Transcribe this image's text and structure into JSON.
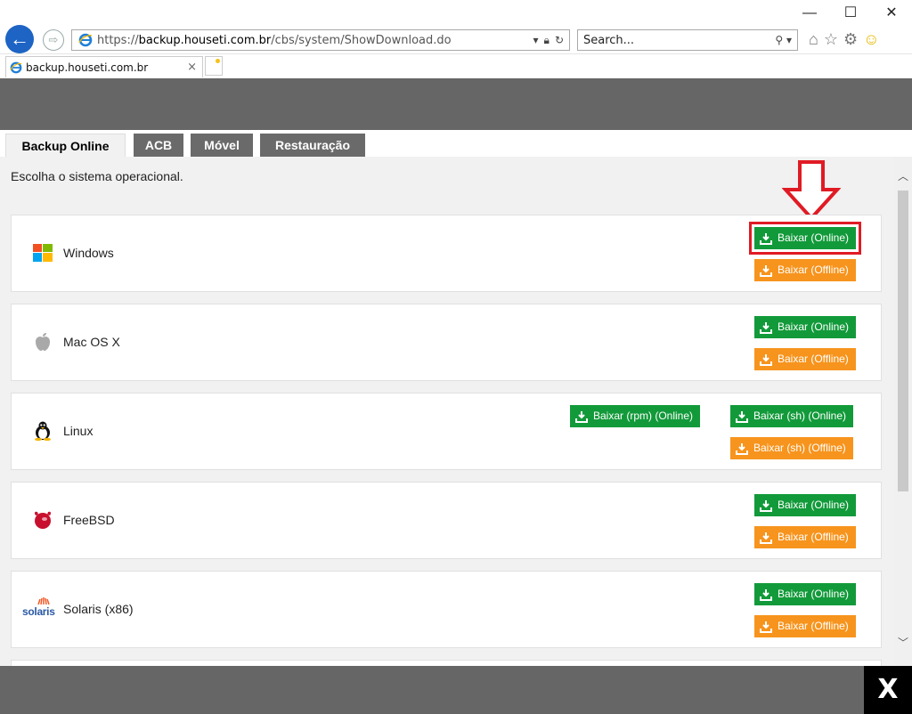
{
  "browser": {
    "window_controls": {
      "minimize": "—",
      "maximize": "☐",
      "close": "✕"
    },
    "url": {
      "scheme": "https://",
      "host": "backup.houseti.com.br",
      "path": "/cbs/system/ShowDownload.do"
    },
    "search_placeholder": "Search...",
    "tab_title": "backup.houseti.com.br",
    "icons": [
      "back-icon",
      "forward-icon",
      "ie-icon",
      "lock-icon",
      "refresh-icon",
      "search-icon",
      "home-icon",
      "favorites-icon",
      "gear-icon",
      "smiley-icon"
    ],
    "accent_color": "#1d64c4"
  },
  "page": {
    "tabs": [
      {
        "label": "Backup Online",
        "active": true
      },
      {
        "label": "ACB",
        "active": false
      },
      {
        "label": "Móvel",
        "active": false
      },
      {
        "label": "Restauração",
        "active": false
      }
    ],
    "intro": "Escolha o sistema operacional.",
    "colors": {
      "online": "#129a3a",
      "offline": "#f7941d",
      "highlight": "#e01b24",
      "bar": "#666666"
    },
    "os_list": [
      {
        "name": "Windows",
        "icon": "windows-icon",
        "buttons": [
          {
            "label": "Baixar (Online)",
            "style": "online",
            "highlighted": true
          },
          {
            "label": "Baixar (Offline)",
            "style": "offline"
          }
        ]
      },
      {
        "name": "Mac OS X",
        "icon": "apple-icon",
        "buttons": [
          {
            "label": "Baixar (Online)",
            "style": "online"
          },
          {
            "label": "Baixar (Offline)",
            "style": "offline"
          }
        ]
      },
      {
        "name": "Linux",
        "icon": "tux-icon",
        "buttons": [
          {
            "label": "Baixar (rpm) (Online)",
            "style": "online"
          },
          {
            "label": "Baixar (sh) (Online)",
            "style": "online"
          },
          {
            "label": "Baixar (sh) (Offline)",
            "style": "offline"
          }
        ]
      },
      {
        "name": "FreeBSD",
        "icon": "freebsd-icon",
        "buttons": [
          {
            "label": "Baixar (Online)",
            "style": "online"
          },
          {
            "label": "Baixar (Offline)",
            "style": "offline"
          }
        ]
      },
      {
        "name": "Solaris (x86)",
        "icon": "solaris-icon",
        "logo_text": "solaris",
        "buttons": [
          {
            "label": "Baixar (Online)",
            "style": "online"
          },
          {
            "label": "Baixar (Offline)",
            "style": "offline"
          }
        ]
      }
    ],
    "close_label": "X"
  }
}
